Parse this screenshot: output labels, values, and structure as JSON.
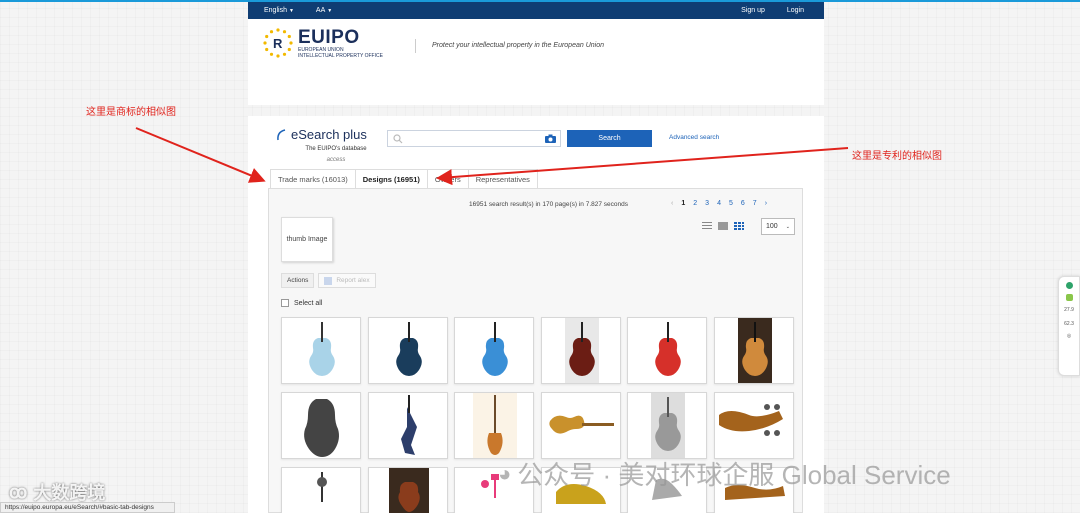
{
  "topbar": {
    "language": "English",
    "font_size": "AA",
    "signup": "Sign up",
    "login": "Login"
  },
  "header": {
    "brand": "EUIPO",
    "brand_sub1": "EUROPEAN UNION",
    "brand_sub2": "INTELLECTUAL PROPERTY OFFICE",
    "tagline": "Protect your intellectual property in the European Union"
  },
  "esearch": {
    "name": "eSearch plus",
    "desc": "The EUIPO's database",
    "access": "access"
  },
  "search": {
    "placeholder": "",
    "button": "Search",
    "advanced": "Advanced search"
  },
  "tabs": [
    {
      "label": "Trade marks (16013)"
    },
    {
      "label": "Designs (16951)"
    },
    {
      "label": "Owners"
    },
    {
      "label": "Representatives"
    }
  ],
  "results": {
    "info": "16951 search result(s) in 170 page(s) in 7.827 seconds",
    "pages": [
      "1",
      "2",
      "3",
      "4",
      "5",
      "6",
      "7"
    ],
    "current_page": "1",
    "per_page": "100"
  },
  "thumb_placeholder": "thumb Image",
  "actions": {
    "label": "Actions",
    "report": "Report alex"
  },
  "select_all": "Select all",
  "annotations": {
    "left": "这里是商标的相似图",
    "right": "这里是专利的相似图"
  },
  "status_url": "https://euipo.europa.eu/eSearch/#basic-tab-designs",
  "watermark_left": "大数跨境",
  "watermark_right": "公众号 · 美对环球企服 Global Service",
  "side_widget": {
    "v1": "27.9",
    "v2": "62.3"
  },
  "colors": {
    "topbar": "#0f3d73",
    "accent": "#1d63b8",
    "annotation": "#e0231c",
    "browser_top": "#1a9ad9"
  }
}
